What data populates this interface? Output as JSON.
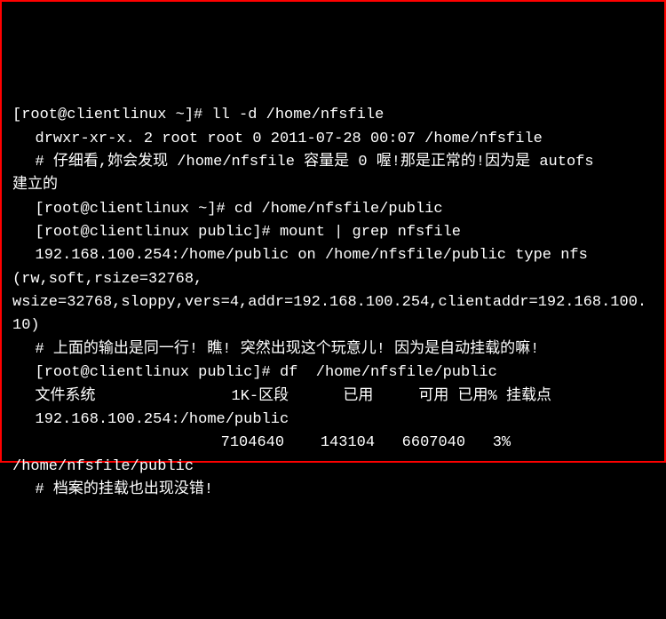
{
  "terminal": {
    "l1": "[root@clientlinux ~]# ll -d /home/nfsfile",
    "l2": "drwxr-xr-x. 2 root root 0 2011-07-28 00:07 /home/nfsfile",
    "l3": "# 仔细看,妳会发现 /home/nfsfile 容量是 0 喔!那是正常的!因为是 autofs",
    "l4": "建立的",
    "l5": "",
    "l6": "[root@clientlinux ~]# cd /home/nfsfile/public",
    "l7": "[root@clientlinux public]# mount | grep nfsfile",
    "l8": "192.168.100.254:/home/public on /home/nfsfile/public type nfs ",
    "l9": "(rw,soft,rsize=32768,",
    "l10": "",
    "l11": "wsize=32768,sloppy,vers=4,addr=192.168.100.254,clientaddr=192.168.100.10)",
    "l12": "# 上面的输出是同一行! 瞧! 突然出现这个玩意儿! 因为是自动挂载的嘛!",
    "l13": "",
    "l14": "[root@clientlinux public]# df  /home/nfsfile/public",
    "l15": "文件系统               1K-区段      已用     可用 已用% 挂载点",
    "l16": "192.168.100.254:/home/public",
    "l17": "                       7104640    143104   6607040   3%   ",
    "l18": "/home/nfsfile/public",
    "l19": "# 档案的挂载也出现没错!"
  }
}
